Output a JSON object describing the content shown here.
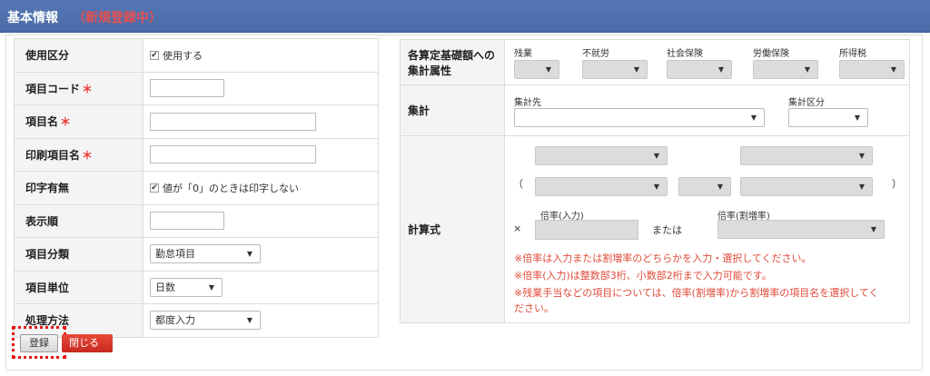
{
  "header": {
    "title": "基本情報",
    "subtitle": "（新規登録中）"
  },
  "left_table": {
    "usage": {
      "label": "使用区分",
      "check_label": "使用する"
    },
    "item_code": {
      "label": "項目コード",
      "required": "＊",
      "value": ""
    },
    "item_name": {
      "label": "項目名",
      "required": "＊",
      "value": ""
    },
    "print_name": {
      "label": "印刷項目名",
      "required": "＊",
      "value": ""
    },
    "print_flag": {
      "label": "印字有無",
      "check_label": "値が「0」のときは印字しない"
    },
    "display_order": {
      "label": "表示順",
      "value": ""
    },
    "category": {
      "label": "項目分類",
      "selected": "勤怠項目"
    },
    "unit": {
      "label": "項目単位",
      "selected": "日数"
    },
    "method": {
      "label": "処理方法",
      "selected": "都度入力"
    }
  },
  "right_table": {
    "attributes": {
      "label": "各算定基礎額への集計属性",
      "columns": [
        "残業",
        "不就労",
        "社会保険",
        "労働保険",
        "所得税"
      ]
    },
    "aggregate": {
      "label": "集計",
      "target_label": "集計先",
      "type_label": "集計区分"
    },
    "formula": {
      "label": "計算式",
      "open_paren": "（",
      "close_paren": "）",
      "times": "×",
      "rate_input_label": "倍率(入力)",
      "or_text": "または",
      "rate_premium_label": "倍率(割増率)",
      "notes": [
        "※倍率は入力または割増率のどちらかを入力・選択してください。",
        "※倍率(入力)は整数部3桁、小数部2桁まで入力可能です。",
        "※残業手当などの項目については、倍率(割増率)から割増率の項目名を選択してく",
        "ださい。"
      ]
    }
  },
  "buttons": {
    "register": "登録",
    "close": "閉じる"
  },
  "colors": {
    "header_bg": "#4a6aa6",
    "required": "#e33333",
    "note": "#e04a3a",
    "close_button": "#d4321f"
  }
}
